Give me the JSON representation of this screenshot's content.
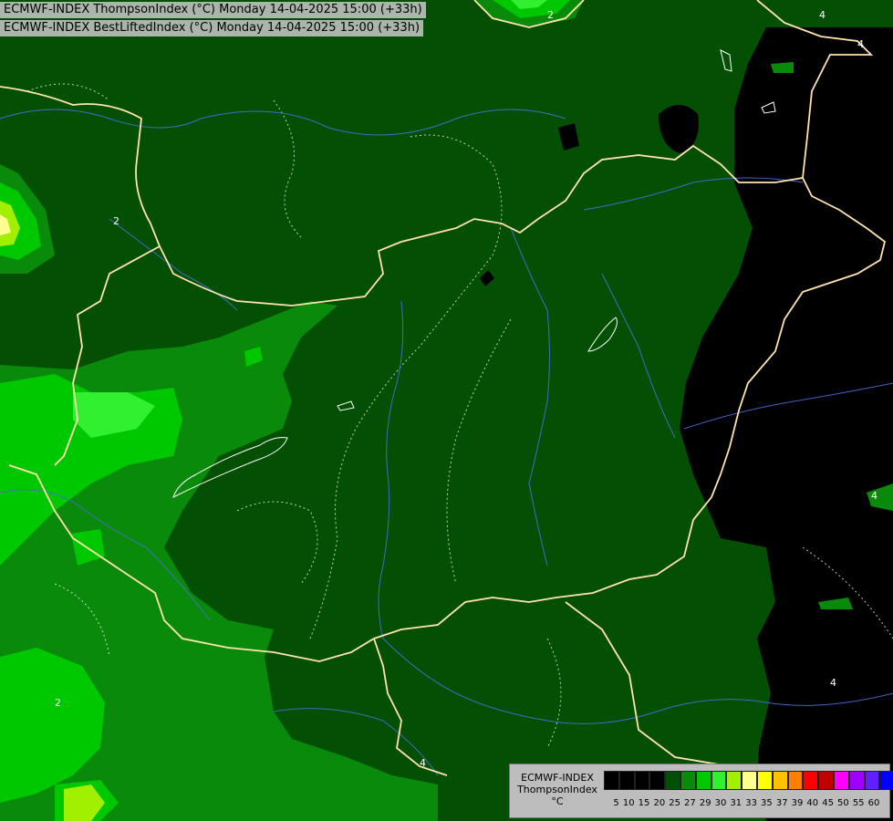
{
  "header": {
    "line1": "ECMWF-INDEX ThompsonIndex (°C) Monday 14-04-2025 15:00 (+33h)",
    "line2": "ECMWF-INDEX BestLiftedIndex (°C) Monday 14-04-2025 15:00 (+33h)"
  },
  "legend": {
    "line1": "ECMWF-INDEX",
    "line2": "ThompsonIndex",
    "line3": "°C",
    "ticks": [
      "5",
      "10",
      "15",
      "20",
      "25",
      "27",
      "29",
      "30",
      "31",
      "33",
      "35",
      "37",
      "39",
      "40",
      "45",
      "50",
      "55",
      "60"
    ],
    "colors": [
      "#000000",
      "#000000",
      "#000000",
      "#000000",
      "#034f03",
      "#0a8a0a",
      "#00c800",
      "#30f030",
      "#a0f000",
      "#ffff90",
      "#ffff00",
      "#ffc000",
      "#ff8000",
      "#ff0000",
      "#c00000",
      "#ff00ff",
      "#a000ff",
      "#6020ff",
      "#0000ff"
    ]
  },
  "contour_labels": [
    "2",
    "2",
    "4",
    "4",
    "4",
    "2",
    "4",
    "4"
  ],
  "palette": {
    "dark_green": "#034f03",
    "mid_green": "#0a8a0a",
    "bright_green": "#00c800",
    "light_green": "#30f030",
    "black": "#000000",
    "yellow_green": "#a0f000",
    "light_yellow": "#ffff90",
    "border": "#ffe4b0",
    "river": "#4a6dd6"
  }
}
